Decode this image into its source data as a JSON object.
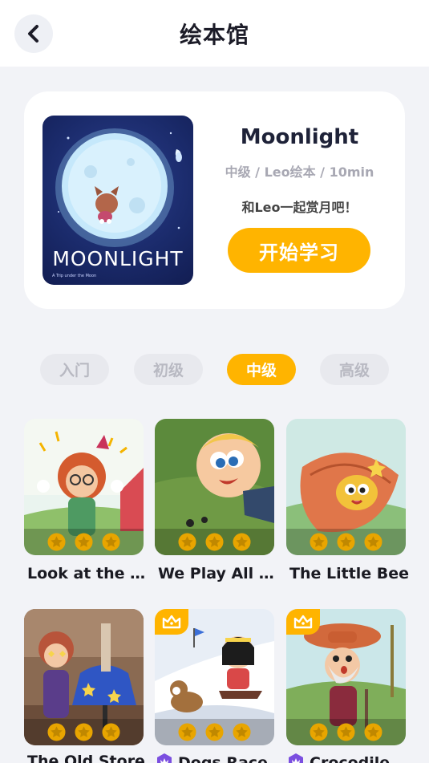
{
  "header": {
    "title": "绘本馆",
    "back_icon": "chevron-left-icon"
  },
  "featured": {
    "cover_title": "MOONLIGHT",
    "cover_subtitle": "A Trip under the Moon",
    "title": "Moonlight",
    "meta": "中级 / Leo绘本 / 10min",
    "description": "和Leo一起赏月吧！",
    "start_label": "开始学习"
  },
  "levels": [
    {
      "label": "入门",
      "active": false
    },
    {
      "label": "初级",
      "active": false
    },
    {
      "label": "中级",
      "active": true
    },
    {
      "label": "高级",
      "active": false
    }
  ],
  "books": [
    {
      "title": "Look at the …",
      "stars_earned": 0,
      "stars_total": 3,
      "premium": false
    },
    {
      "title": "We Play All …",
      "stars_earned": 0,
      "stars_total": 3,
      "premium": false
    },
    {
      "title": "The Little Bees!",
      "stars_earned": 0,
      "stars_total": 3,
      "premium": false
    },
    {
      "title": "The Old Store!",
      "stars_earned": 0,
      "stars_total": 3,
      "premium": false
    },
    {
      "title": "Dogs Race…",
      "stars_earned": 0,
      "stars_total": 3,
      "premium": true
    },
    {
      "title": "Crocodile …",
      "stars_earned": 0,
      "stars_total": 3,
      "premium": true
    }
  ],
  "colors": {
    "accent": "#ffb400",
    "background": "#f2f3f7",
    "premium": "#7b4fe0"
  }
}
